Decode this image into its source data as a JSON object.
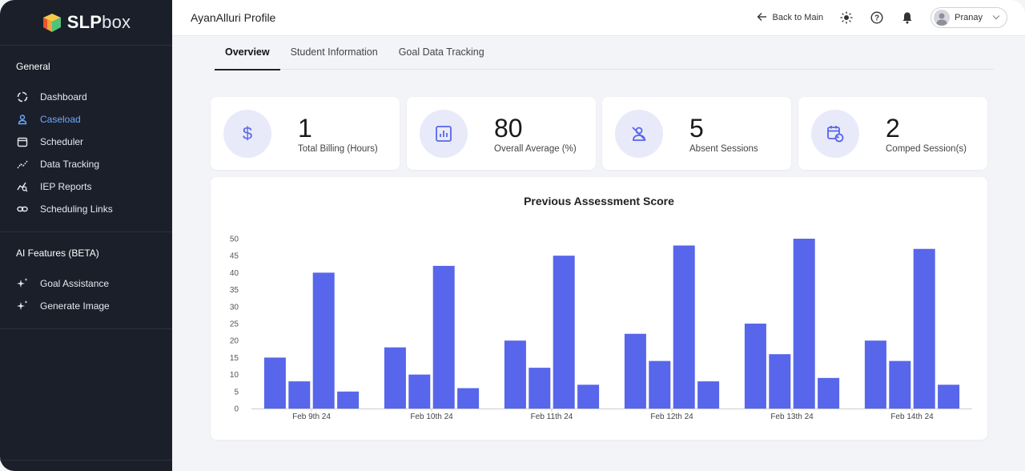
{
  "brand": {
    "name_bold": "SLP",
    "name_light": "box"
  },
  "sidebar": {
    "general_title": "General",
    "items": [
      {
        "label": "Dashboard",
        "icon": "dashboard-icon"
      },
      {
        "label": "Caseload",
        "icon": "user-icon",
        "active": true
      },
      {
        "label": "Scheduler",
        "icon": "calendar-icon"
      },
      {
        "label": "Data Tracking",
        "icon": "trend-icon"
      },
      {
        "label": "IEP Reports",
        "icon": "report-search-icon"
      },
      {
        "label": "Scheduling Links",
        "icon": "link-icon"
      }
    ],
    "ai_title": "AI Features (BETA)",
    "ai_items": [
      {
        "label": "Goal Assistance",
        "icon": "sparkle-icon"
      },
      {
        "label": "Generate Image",
        "icon": "sparkle-icon"
      }
    ]
  },
  "header": {
    "title": "AyanAlluri Profile",
    "back_label": "Back to Main",
    "user_name": "Pranay"
  },
  "tabs": [
    {
      "label": "Overview",
      "active": true
    },
    {
      "label": "Student Information"
    },
    {
      "label": "Goal Data Tracking"
    }
  ],
  "stats": [
    {
      "value": "1",
      "label": "Total Billing (Hours)",
      "icon": "dollar-icon"
    },
    {
      "value": "80",
      "label": "Overall Average (%)",
      "icon": "bar-chart-icon"
    },
    {
      "value": "5",
      "label": "Absent Sessions",
      "icon": "user-off-icon"
    },
    {
      "value": "2",
      "label": "Comped Session(s)",
      "icon": "calendar-refresh-icon"
    }
  ],
  "colors": {
    "accent": "#5766ea",
    "active_nav": "#6ea8ff",
    "sidebar_bg": "#1b1f2a"
  },
  "chart_data": {
    "type": "bar",
    "title": "Previous Assessment Score",
    "categories": [
      "Feb 9th 24",
      "Feb 10th 24",
      "Feb 11th 24",
      "Feb 12th 24",
      "Feb 13th 24",
      "Feb 14th 24"
    ],
    "series": [
      {
        "values": [
          15,
          18,
          20,
          22,
          25,
          20
        ]
      },
      {
        "values": [
          8,
          10,
          12,
          14,
          16,
          14
        ]
      },
      {
        "values": [
          40,
          42,
          45,
          48,
          50,
          47
        ]
      },
      {
        "values": [
          5,
          6,
          7,
          8,
          9,
          7
        ]
      }
    ],
    "ylim": [
      0,
      50
    ],
    "yticks": [
      0,
      5,
      10,
      15,
      20,
      25,
      30,
      35,
      40,
      45,
      50
    ],
    "grid": false,
    "legend": "none",
    "color": "#5766ea"
  }
}
